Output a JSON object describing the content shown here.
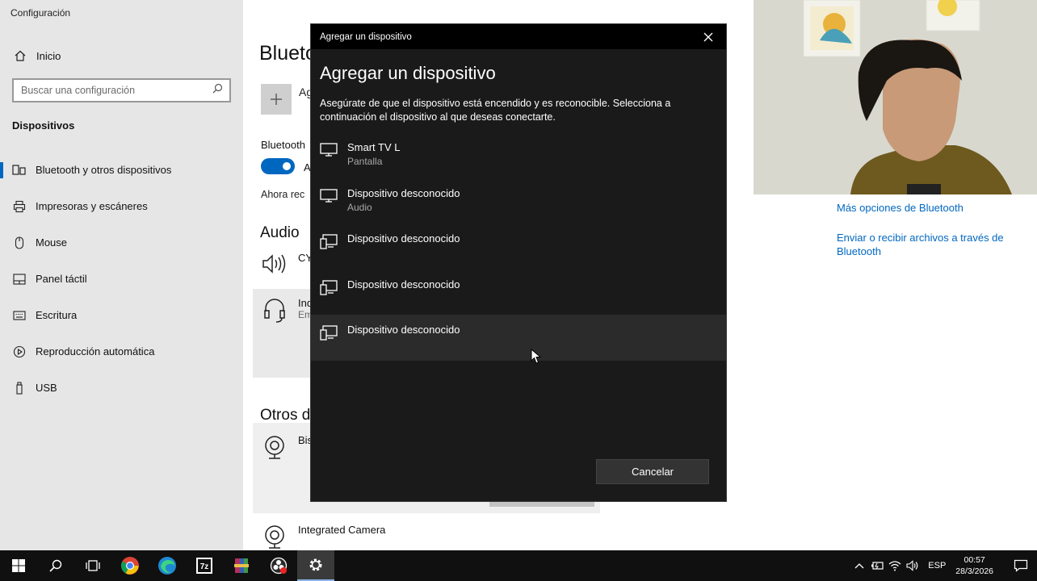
{
  "settings": {
    "app_title": "Configuración",
    "home_label": "Inicio",
    "search_placeholder": "Buscar una configuración",
    "section_label": "Dispositivos",
    "nav": [
      {
        "label": "Bluetooth y otros dispositivos",
        "icon": "bluetooth-devices-icon",
        "active": true
      },
      {
        "label": "Impresoras y escáneres",
        "icon": "printer-icon"
      },
      {
        "label": "Mouse",
        "icon": "mouse-icon"
      },
      {
        "label": "Panel táctil",
        "icon": "touchpad-icon"
      },
      {
        "label": "Escritura",
        "icon": "keyboard-icon"
      },
      {
        "label": "Reproducción automática",
        "icon": "autoplay-icon"
      },
      {
        "label": "USB",
        "icon": "usb-icon"
      }
    ]
  },
  "main": {
    "heading": "Blueto",
    "add_text": "Ag",
    "bluetooth_label": "Bluetooth",
    "toggle_text": "A",
    "discover_text": "Ahora rec",
    "audio_heading": "Audio",
    "audio_device_1": "CY",
    "audio_device_2_name": "Ind",
    "audio_device_2_sub": "Em",
    "otros_heading": "Otros d",
    "otros_device_1": "Bis",
    "otros_device_2": "Integrated Camera"
  },
  "side_links": {
    "more_bt": "Más opciones de Bluetooth",
    "send_files": "Enviar o recibir archivos a través de Bluetooth"
  },
  "dialog": {
    "title_bar": "Agregar un dispositivo",
    "heading": "Agregar un dispositivo",
    "description": "Asegúrate de que el dispositivo está encendido y es reconocible. Selecciona a continuación el dispositivo al que deseas conectarte.",
    "devices": [
      {
        "name": "Smart TV L",
        "type": "Pantalla",
        "icon": "monitor-icon"
      },
      {
        "name": "Dispositivo desconocido",
        "type": "Audio",
        "icon": "monitor-icon"
      },
      {
        "name": "Dispositivo desconocido",
        "type": "",
        "icon": "devices-icon"
      },
      {
        "name": "Dispositivo desconocido",
        "type": "",
        "icon": "devices-icon"
      },
      {
        "name": "Dispositivo desconocido",
        "type": "",
        "icon": "devices-icon",
        "hovered": true
      }
    ],
    "cancel_label": "Cancelar"
  },
  "taskbar": {
    "apps": [
      "start-icon",
      "search-icon",
      "task-view-icon",
      "chrome-icon",
      "edge-icon",
      "7zip-icon",
      "winrar-icon",
      "obs-icon",
      "settings-icon"
    ],
    "active_app": "settings-icon",
    "language": "ESP",
    "time": "00:57",
    "date": "28/3/2026"
  },
  "colors": {
    "accent": "#0067c0",
    "dialog_bg": "#1a1a1a",
    "taskbar_bg": "#101010"
  }
}
